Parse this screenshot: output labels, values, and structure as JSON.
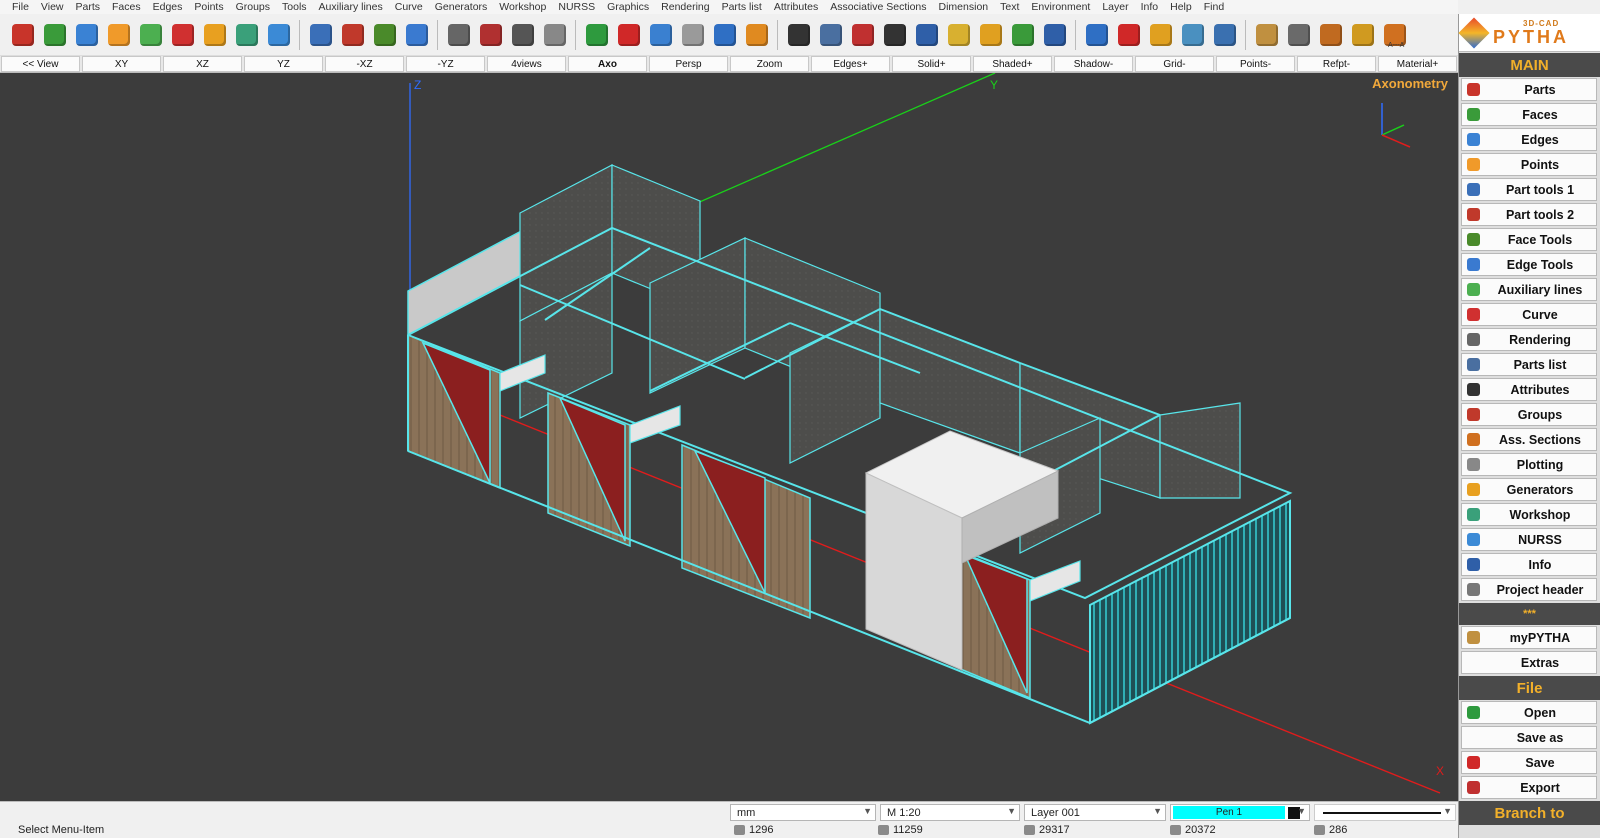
{
  "menu": [
    "File",
    "View",
    "Parts",
    "Faces",
    "Edges",
    "Points",
    "Groups",
    "Tools",
    "Auxiliary lines",
    "Curve",
    "Generators",
    "Workshop",
    "NURSS",
    "Graphics",
    "Rendering",
    "Parts list",
    "Attributes",
    "Associative Sections",
    "Dimension",
    "Text",
    "Environment",
    "Layer",
    "Info",
    "Help",
    "Find"
  ],
  "toolbar_icons": [
    {
      "name": "parts-icon",
      "color": "#c8342a"
    },
    {
      "name": "faces-icon",
      "color": "#3a9b3a"
    },
    {
      "name": "edges-icon",
      "color": "#3a82d4"
    },
    {
      "name": "points-icon",
      "color": "#f09a2a"
    },
    {
      "name": "auxiliary-lines-icon",
      "color": "#4caf50"
    },
    {
      "name": "curve-icon",
      "color": "#d03030"
    },
    {
      "name": "generators-icon",
      "color": "#e8a020"
    },
    {
      "name": "drill-icon",
      "color": "#3aa07a"
    },
    {
      "name": "nurss-icon",
      "color": "#3b8ad6"
    },
    {
      "name": "part-tools-icon",
      "color": "#3a6fb8"
    },
    {
      "name": "part-tools-2-icon",
      "color": "#c0392b"
    },
    {
      "name": "face-tools-icon",
      "color": "#4a8a2a"
    },
    {
      "name": "edge-tools-icon",
      "color": "#3a7ad0"
    },
    {
      "name": "camera-icon",
      "color": "#666666"
    },
    {
      "name": "render-icon",
      "color": "#b03030"
    },
    {
      "name": "eye-icon",
      "color": "#555555"
    },
    {
      "name": "printer-icon",
      "color": "#888888"
    },
    {
      "name": "import-icon",
      "color": "#2e9a3e"
    },
    {
      "name": "export-icon",
      "color": "#d02828"
    },
    {
      "name": "drop-icon",
      "color": "#3a80d0"
    },
    {
      "name": "cup-icon",
      "color": "#9a9a9a"
    },
    {
      "name": "undo-icon",
      "color": "#2f6fc4"
    },
    {
      "name": "redo-icon",
      "color": "#e08a20"
    },
    {
      "name": "attributes-icon",
      "color": "#333333"
    },
    {
      "name": "parts-list-icon",
      "color": "#4a6fa0"
    },
    {
      "name": "pen-lines-icon",
      "color": "#c03030"
    },
    {
      "name": "dimension-icon",
      "color": "#333333"
    },
    {
      "name": "document-icon",
      "color": "#2f5fa8"
    },
    {
      "name": "hatch-icon",
      "color": "#d8b030"
    },
    {
      "name": "layers-icon",
      "color": "#e0a020"
    },
    {
      "name": "tree-icon",
      "color": "#3a9a3a"
    },
    {
      "name": "info-icon",
      "color": "#2f5fa8"
    },
    {
      "name": "refresh-icon",
      "color": "#2f6fc4"
    },
    {
      "name": "delete-icon",
      "color": "#d02828"
    },
    {
      "name": "move-icon",
      "color": "#e0a020"
    },
    {
      "name": "stack-icon",
      "color": "#4a90c0"
    },
    {
      "name": "copy-icon",
      "color": "#3a70b0"
    },
    {
      "name": "workshop-icon",
      "color": "#c09040"
    },
    {
      "name": "saw-icon",
      "color": "#6a6a6a"
    },
    {
      "name": "plane-icon",
      "color": "#c06a20"
    },
    {
      "name": "grinder-icon",
      "color": "#d09a20"
    },
    {
      "name": "scissors-icon",
      "color": "#d07020"
    }
  ],
  "toolbar_extra_text": "A---A",
  "view_buttons": [
    "<< View",
    "XY",
    "XZ",
    "YZ",
    "-XZ",
    "-YZ",
    "4views",
    "Axo",
    "Persp",
    "Zoom",
    "Edges+",
    "Solid+",
    "Shaded+",
    "Shadow-",
    "Grid-",
    "Points-",
    "Refpt-",
    "Material+"
  ],
  "active_view": "Axo",
  "viewport": {
    "label": "Axonometry",
    "axis_z": "Z",
    "axis_y": "Y",
    "axis_x": "X"
  },
  "panel": {
    "logo_sub": "3D-CAD",
    "logo_name": "PYTHA",
    "main_header": "MAIN",
    "main_items": [
      {
        "label": "Parts",
        "color": "#c8342a"
      },
      {
        "label": "Faces",
        "color": "#3a9b3a"
      },
      {
        "label": "Edges",
        "color": "#3a82d4"
      },
      {
        "label": "Points",
        "color": "#f09a2a"
      },
      {
        "label": "Part tools 1",
        "color": "#3a6fb8"
      },
      {
        "label": "Part tools 2",
        "color": "#c0392b"
      },
      {
        "label": "Face Tools",
        "color": "#4a8a2a"
      },
      {
        "label": "Edge Tools",
        "color": "#3a7ad0"
      },
      {
        "label": "Auxiliary lines",
        "color": "#4caf50"
      },
      {
        "label": "Curve",
        "color": "#d03030"
      },
      {
        "label": "Rendering",
        "color": "#666666"
      },
      {
        "label": "Parts list",
        "color": "#4a6fa0"
      },
      {
        "label": "Attributes",
        "color": "#333333"
      },
      {
        "label": "Groups",
        "color": "#c0392b"
      },
      {
        "label": "Ass. Sections",
        "color": "#d07020"
      },
      {
        "label": "Plotting",
        "color": "#888888"
      },
      {
        "label": "Generators",
        "color": "#e8a020"
      },
      {
        "label": "Workshop",
        "color": "#3aa07a"
      },
      {
        "label": "NURSS",
        "color": "#3b8ad6"
      },
      {
        "label": "Info",
        "color": "#2f5fa8"
      },
      {
        "label": "Project header",
        "color": "#777777"
      }
    ],
    "stars": "***",
    "extra_items": [
      {
        "label": "myPYTHA",
        "color": "#c09040"
      },
      {
        "label": "Extras",
        "color": ""
      }
    ],
    "file_header": "File",
    "file_items": [
      {
        "label": "Open",
        "color": "#2e9a3e"
      },
      {
        "label": "Save as",
        "color": ""
      },
      {
        "label": "Save",
        "color": "#d02828"
      },
      {
        "label": "Export",
        "color": "#c03030"
      }
    ],
    "branch_header": "Branch to"
  },
  "status": {
    "units": "mm",
    "scale": "M 1:20",
    "layer": "Layer 001",
    "pen": "Pen 1",
    "pen_color": "#00ffff",
    "message": "Select Menu-Item",
    "counts": [
      "1296",
      "11259",
      "29317",
      "20372",
      "286"
    ]
  }
}
